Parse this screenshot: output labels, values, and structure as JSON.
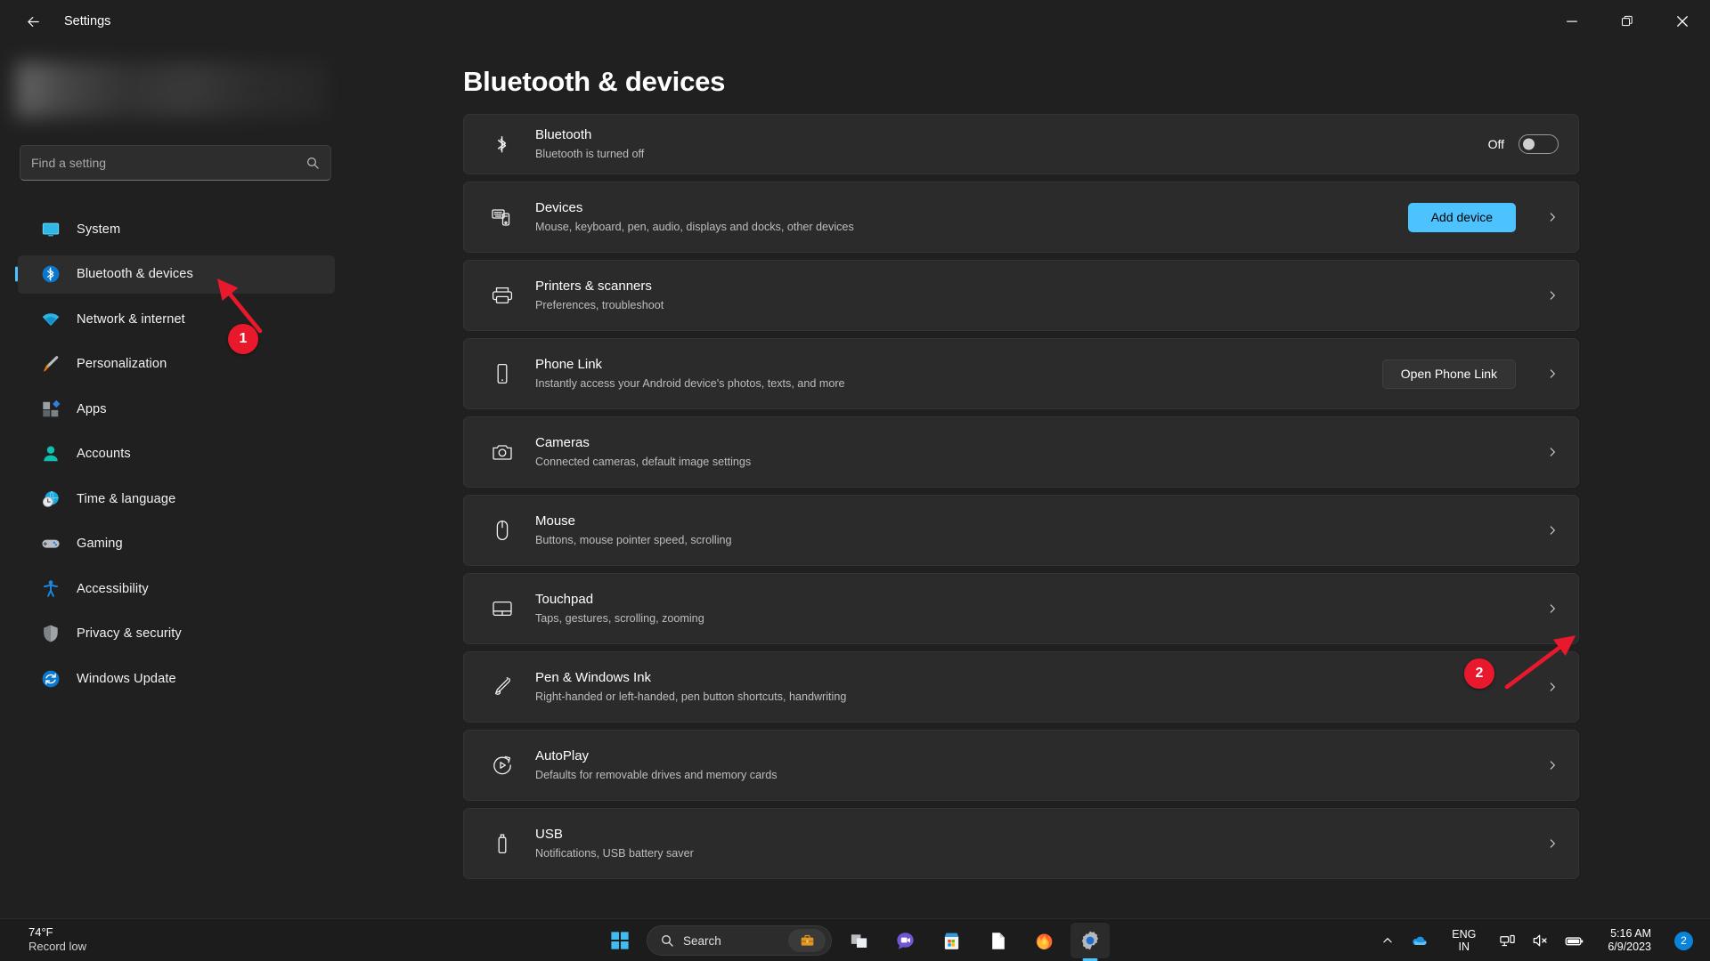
{
  "window": {
    "title": "Settings",
    "back_icon": "back-arrow-icon",
    "minimize_label": "Minimize",
    "maximize_label": "Restore",
    "close_label": "Close"
  },
  "sidebar": {
    "search": {
      "placeholder": "Find a setting",
      "icon": "search-icon"
    },
    "items": [
      {
        "label": "System",
        "icon": "system-icon",
        "active": false
      },
      {
        "label": "Bluetooth & devices",
        "icon": "bluetooth-icon",
        "active": true
      },
      {
        "label": "Network & internet",
        "icon": "wifi-icon",
        "active": false
      },
      {
        "label": "Personalization",
        "icon": "paintbrush-icon",
        "active": false
      },
      {
        "label": "Apps",
        "icon": "apps-icon",
        "active": false
      },
      {
        "label": "Accounts",
        "icon": "account-icon",
        "active": false
      },
      {
        "label": "Time & language",
        "icon": "clock-globe-icon",
        "active": false
      },
      {
        "label": "Gaming",
        "icon": "gamepad-icon",
        "active": false
      },
      {
        "label": "Accessibility",
        "icon": "accessibility-icon",
        "active": false
      },
      {
        "label": "Privacy & security",
        "icon": "shield-icon",
        "active": false
      },
      {
        "label": "Windows Update",
        "icon": "update-icon",
        "active": false
      }
    ]
  },
  "main": {
    "page_title": "Bluetooth & devices",
    "bluetooth": {
      "title": "Bluetooth",
      "subtitle": "Bluetooth is turned off",
      "toggle_state": "Off",
      "icon": "bluetooth-icon"
    },
    "rows": [
      {
        "title": "Devices",
        "subtitle": "Mouse, keyboard, pen, audio, displays and docks, other devices",
        "icon": "devices-icon",
        "button": {
          "label": "Add device",
          "style": "accent"
        }
      },
      {
        "title": "Printers & scanners",
        "subtitle": "Preferences, troubleshoot",
        "icon": "printer-icon",
        "button": null
      },
      {
        "title": "Phone Link",
        "subtitle": "Instantly access your Android device's photos, texts, and more",
        "icon": "phone-icon",
        "button": {
          "label": "Open Phone Link",
          "style": "secondary"
        }
      },
      {
        "title": "Cameras",
        "subtitle": "Connected cameras, default image settings",
        "icon": "camera-icon",
        "button": null
      },
      {
        "title": "Mouse",
        "subtitle": "Buttons, mouse pointer speed, scrolling",
        "icon": "mouse-icon",
        "button": null
      },
      {
        "title": "Touchpad",
        "subtitle": "Taps, gestures, scrolling, zooming",
        "icon": "touchpad-icon",
        "button": null
      },
      {
        "title": "Pen & Windows Ink",
        "subtitle": "Right-handed or left-handed, pen button shortcuts, handwriting",
        "icon": "pen-icon",
        "button": null
      },
      {
        "title": "AutoPlay",
        "subtitle": "Defaults for removable drives and memory cards",
        "icon": "autoplay-icon",
        "button": null
      },
      {
        "title": "USB",
        "subtitle": "Notifications, USB battery saver",
        "icon": "usb-icon",
        "button": null
      }
    ]
  },
  "annotations": [
    {
      "number": "1",
      "target": "sidebar-item-bluetooth-devices"
    },
    {
      "number": "2",
      "target": "touchpad-row-chevron"
    }
  ],
  "taskbar": {
    "weather": {
      "temperature": "74°F",
      "condition": "Record low"
    },
    "start_label": "Start",
    "search": {
      "label": "Search",
      "icon": "search-icon",
      "pill_icon": "briefcase-icon"
    },
    "apps": [
      {
        "name": "file-explorer",
        "active": false
      },
      {
        "name": "teams-chat",
        "active": false
      },
      {
        "name": "microsoft-store",
        "active": false
      },
      {
        "name": "document",
        "active": false
      },
      {
        "name": "firefox",
        "active": false
      },
      {
        "name": "settings",
        "active": true
      }
    ],
    "tray": {
      "chevron_icon": "chevron-up-icon",
      "onedrive_icon": "onedrive-icon",
      "language": {
        "line1": "ENG",
        "line2": "IN"
      },
      "network_icon": "network-icon",
      "volume_icon": "volume-muted-icon",
      "battery_icon": "battery-icon",
      "time": "5:16 AM",
      "date": "6/9/2023",
      "notification_count": "2"
    }
  },
  "colors": {
    "accent": "#4cc2ff",
    "annotation": "#e8192c",
    "window_bg": "#202020",
    "card_bg": "#2b2b2b"
  }
}
